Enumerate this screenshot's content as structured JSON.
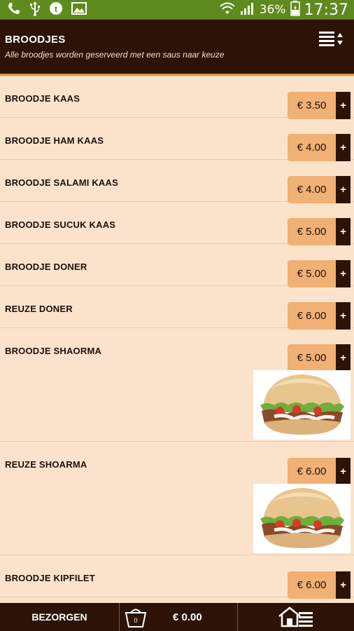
{
  "status_bar": {
    "icons": [
      "phone-icon",
      "usb-icon",
      "chat-icon",
      "image-icon",
      "wifi-icon",
      "signal-icon",
      "battery-icon"
    ],
    "battery": "36%",
    "time": "17:37"
  },
  "header": {
    "title": "BROODJES",
    "subtitle": "Alle broodjes worden geserveerd met een saus naar keuze",
    "sort_icon": "sort-list-icon"
  },
  "items": [
    {
      "name": "BROODJE KAAS",
      "price": "€ 3.50",
      "add": "+"
    },
    {
      "name": "BROODJE HAM KAAS",
      "price": "€ 4.00",
      "add": "+"
    },
    {
      "name": "BROODJE SALAMI KAAS",
      "price": "€ 4.00",
      "add": "+"
    },
    {
      "name": "BROODJE SUCUK KAAS",
      "price": "€ 5.00",
      "add": "+"
    },
    {
      "name": "BROODJE DONER",
      "price": "€ 5.00",
      "add": "+"
    },
    {
      "name": "REUZE DONER",
      "price": "€ 6.00",
      "add": "+"
    },
    {
      "name": "BROODJE SHAORMA",
      "price": "€ 5.00",
      "add": "+"
    },
    {
      "name": "REUZE SHOARMA",
      "price": "€ 6.00",
      "add": "+"
    },
    {
      "name": "BROODJE KIPFILET",
      "price": "€ 6.00",
      "add": "+"
    }
  ],
  "bottom_bar": {
    "deliver_label": "BEZORGEN",
    "cart_count": "0",
    "total": "€ 0.00",
    "home_icon": "home-menu-icon"
  },
  "colors": {
    "status_bar": "#5e8a1e",
    "header_bg": "#2c1305",
    "accent_line": "#e08b2f",
    "list_bg": "#fbe3cb",
    "price_bg": "#f1b074"
  }
}
